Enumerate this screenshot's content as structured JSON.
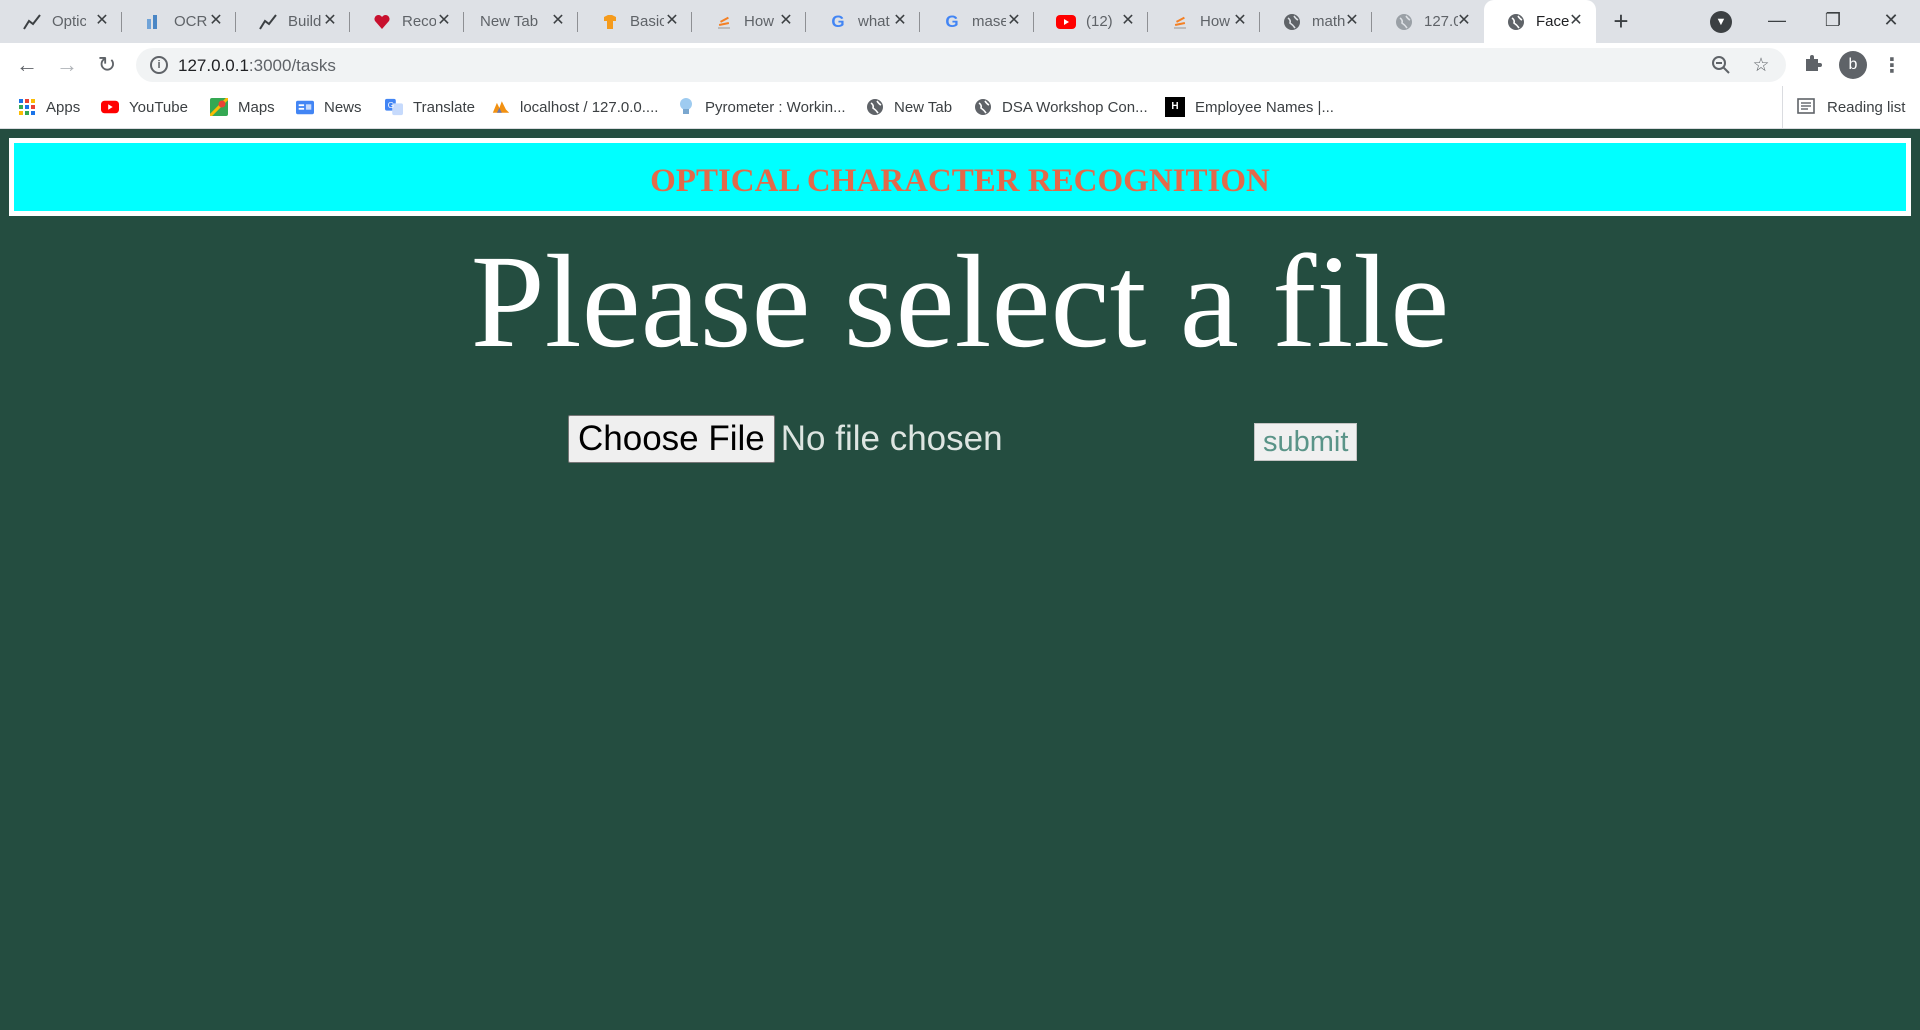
{
  "browser": {
    "tabs": [
      {
        "label": "Optic",
        "icon": "trend-icon",
        "active": false
      },
      {
        "label": "OCR",
        "icon": "ocr-icon",
        "active": false
      },
      {
        "label": "Build",
        "icon": "trend-icon",
        "active": false
      },
      {
        "label": "Reco",
        "icon": "heart-icon",
        "active": false
      },
      {
        "label": "New Tab",
        "icon": "",
        "active": false
      },
      {
        "label": "Basic",
        "icon": "shirt-icon",
        "active": false
      },
      {
        "label": "How",
        "icon": "stack-icon",
        "active": false
      },
      {
        "label": "what",
        "icon": "google-icon",
        "active": false
      },
      {
        "label": "mase",
        "icon": "google-icon",
        "active": false
      },
      {
        "label": "(12)",
        "icon": "youtube-icon",
        "active": false
      },
      {
        "label": "How",
        "icon": "stack-icon",
        "active": false
      },
      {
        "label": "math",
        "icon": "globe-icon",
        "active": false
      },
      {
        "label": "127.0",
        "icon": "globe-icon",
        "active": false
      },
      {
        "label": "Face",
        "icon": "globe-icon",
        "active": true
      }
    ],
    "address": {
      "host": "127.0.0.1",
      "path": ":3000/tasks"
    },
    "avatar_letter": "b",
    "bookmarks": [
      {
        "label": "Apps",
        "icon": "apps-grid-icon"
      },
      {
        "label": "YouTube",
        "icon": "youtube-icon"
      },
      {
        "label": "Maps",
        "icon": "maps-icon"
      },
      {
        "label": "News",
        "icon": "news-icon"
      },
      {
        "label": "Translate",
        "icon": "translate-icon"
      },
      {
        "label": "localhost / 127.0.0....",
        "icon": "phpmyadmin-icon"
      },
      {
        "label": "Pyrometer : Workin...",
        "icon": "bulb-icon"
      },
      {
        "label": "New Tab",
        "icon": "globe-icon"
      },
      {
        "label": "DSA Workshop Con...",
        "icon": "globe-icon"
      },
      {
        "label": "Employee Names |...",
        "icon": "hackerearth-icon"
      }
    ],
    "reading_list": "Reading list"
  },
  "page": {
    "banner_title": "OPTICAL CHARACTER RECOGNITION",
    "heading": "Please select a file",
    "choose_file_label": "Choose File",
    "file_status": "No file chosen",
    "submit_label": "submit"
  },
  "colors": {
    "page_background": "#244d40",
    "banner_background": "#00ffff",
    "banner_text": "#e26a4a",
    "heading_text": "#ffffff"
  }
}
